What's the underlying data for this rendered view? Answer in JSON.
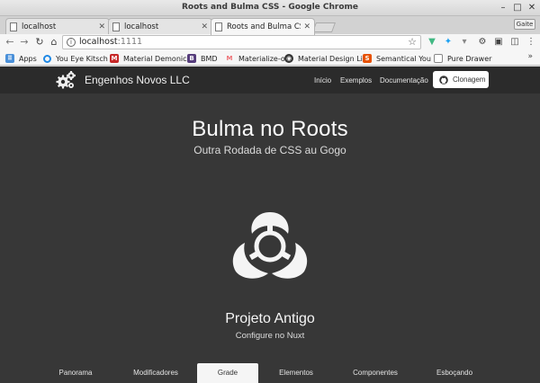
{
  "window": {
    "title": "Roots and Bulma CSS - Google Chrome",
    "controls": [
      "minimize-icon",
      "maximize-icon",
      "close-icon"
    ]
  },
  "tabs": [
    {
      "label": "localhost",
      "active": false
    },
    {
      "label": "localhost",
      "active": false
    },
    {
      "label": "Roots and Bulma CSS",
      "active": true
    }
  ],
  "profile_label": "Gaite",
  "toolbar": {
    "url_host": "localhost",
    "url_port": ":1111",
    "extensions": [
      "vue-icon",
      "twitter-icon",
      "filter-icon",
      "gear-icon",
      "box-icon",
      "cube-icon",
      "menu-icon"
    ]
  },
  "bookmarks": [
    {
      "label": "Apps",
      "icon": "apps-grid-icon",
      "color": "#4a90d9"
    },
    {
      "label": "You Eye Kitsch",
      "icon": "loading-icon",
      "color": "#1e88e5"
    },
    {
      "label": "Material Demonics",
      "icon": "material-icon",
      "color": "#c62828"
    },
    {
      "label": "BMD",
      "icon": "bootstrap-icon",
      "color": "#563d7c"
    },
    {
      "label": "Materialize-o",
      "icon": "materialize-icon",
      "color": "#ee6e73"
    },
    {
      "label": "Material Design Li",
      "icon": "material-design-icon",
      "color": "#333333"
    },
    {
      "label": "Semantical You",
      "icon": "semantic-icon",
      "color": "#e65100"
    },
    {
      "label": "Pure Drawer",
      "icon": "page-icon",
      "color": "#888888"
    }
  ],
  "site": {
    "brand": "Engenhos Novos LLC",
    "nav": [
      "Início",
      "Exemplos",
      "Documentação"
    ],
    "clone_label": "Clonagem",
    "hero_title": "Bulma no Roots",
    "hero_subtitle": "Outra Rodada de CSS au Gogo",
    "project_title": "Projeto Antigo",
    "project_subtitle": "Configure no Nuxt",
    "bottom_tabs": [
      "Panorama",
      "Modificadores",
      "Grade",
      "Elementos",
      "Componentes",
      "Esboçando"
    ],
    "active_bottom_tab": "Grade",
    "colors": {
      "page_bg": "#373737",
      "navbar_bg": "#2b2b2b",
      "text": "#ffffff"
    }
  }
}
